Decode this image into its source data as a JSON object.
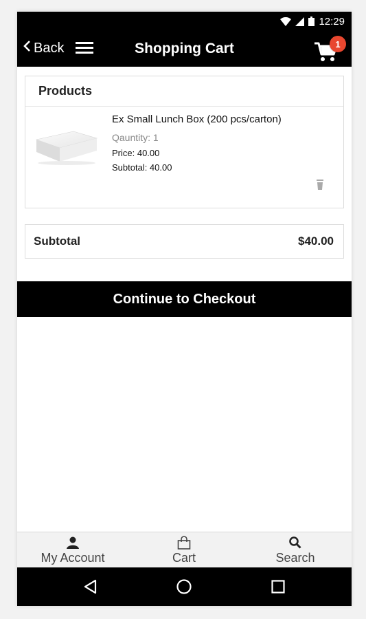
{
  "status_bar": {
    "time": "12:29",
    "icons": [
      "wifi-icon",
      "cell-signal-icon",
      "battery-icon"
    ]
  },
  "header": {
    "back_label": "Back",
    "title": "Shopping Cart",
    "cart_count": "1",
    "icons": [
      "chevron-left-icon",
      "hamburger-menu-icon",
      "cart-icon"
    ]
  },
  "products": {
    "heading": "Products",
    "items": [
      {
        "name": "Ex Small Lunch Box (200 pcs/carton)",
        "quantity": "Qauntity: 1",
        "price": "Price: 40.00",
        "subtotal": "Subtotal: 40.00",
        "image_icon": "lunch-box-image",
        "delete_icon": "trash-icon"
      }
    ]
  },
  "summary": {
    "label": "Subtotal",
    "value": "$40.00"
  },
  "checkout": {
    "label": "Continue to Checkout"
  },
  "tab_bar": {
    "tabs": [
      {
        "label": "My Account",
        "icon": "user-icon"
      },
      {
        "label": "Cart",
        "icon": "shopping-bag-icon"
      },
      {
        "label": "Search",
        "icon": "search-icon"
      }
    ]
  },
  "nav_bar": {
    "icons": [
      "back-triangle-icon",
      "home-circle-icon",
      "recents-square-icon"
    ]
  },
  "colors": {
    "bar_background": "#000000",
    "badge": "#e8472f",
    "tab_bar_background": "#f2f2f2"
  }
}
